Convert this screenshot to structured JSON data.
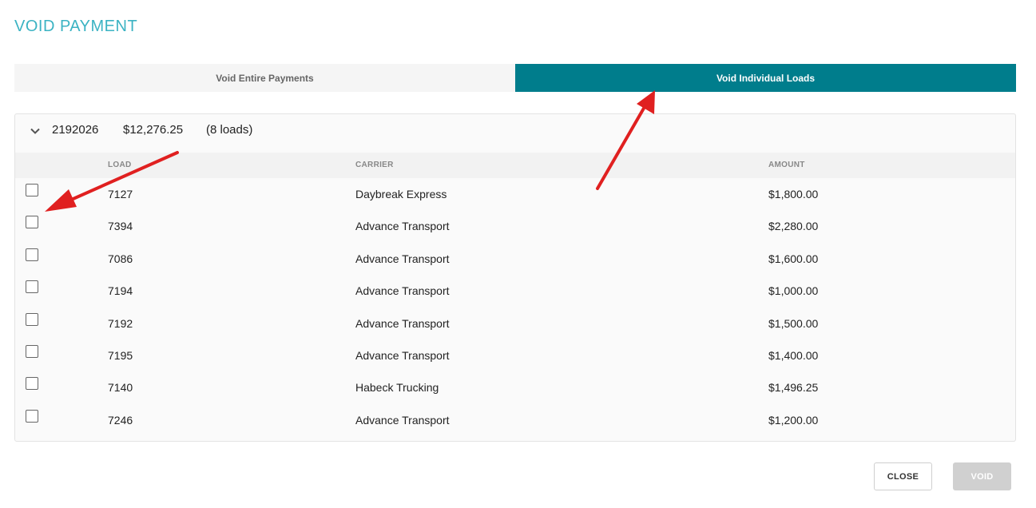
{
  "dialog": {
    "title": "VOID PAYMENT"
  },
  "tabs": [
    {
      "label": "Void Entire Payments",
      "active": false
    },
    {
      "label": "Void Individual Loads",
      "active": true
    }
  ],
  "group": {
    "id": "2192026",
    "amount": "$12,276.25",
    "count": "(8 loads)"
  },
  "columns": {
    "load": "LOAD",
    "carrier": "CARRIER",
    "amount": "AMOUNT"
  },
  "rows": [
    {
      "load": "7127",
      "carrier": "Daybreak Express",
      "amount": "$1,800.00"
    },
    {
      "load": "7394",
      "carrier": "Advance Transport",
      "amount": "$2,280.00"
    },
    {
      "load": "7086",
      "carrier": "Advance Transport",
      "amount": "$1,600.00"
    },
    {
      "load": "7194",
      "carrier": "Advance Transport",
      "amount": "$1,000.00"
    },
    {
      "load": "7192",
      "carrier": "Advance Transport",
      "amount": "$1,500.00"
    },
    {
      "load": "7195",
      "carrier": "Advance Transport",
      "amount": "$1,400.00"
    },
    {
      "load": "7140",
      "carrier": "Habeck Trucking",
      "amount": "$1,496.25"
    },
    {
      "load": "7246",
      "carrier": "Advance Transport",
      "amount": "$1,200.00"
    }
  ],
  "buttons": {
    "close": "CLOSE",
    "void": "VOID"
  },
  "colors": {
    "accent": "#007d8c",
    "title": "#3bb3c3",
    "annotation": "#e02020"
  }
}
